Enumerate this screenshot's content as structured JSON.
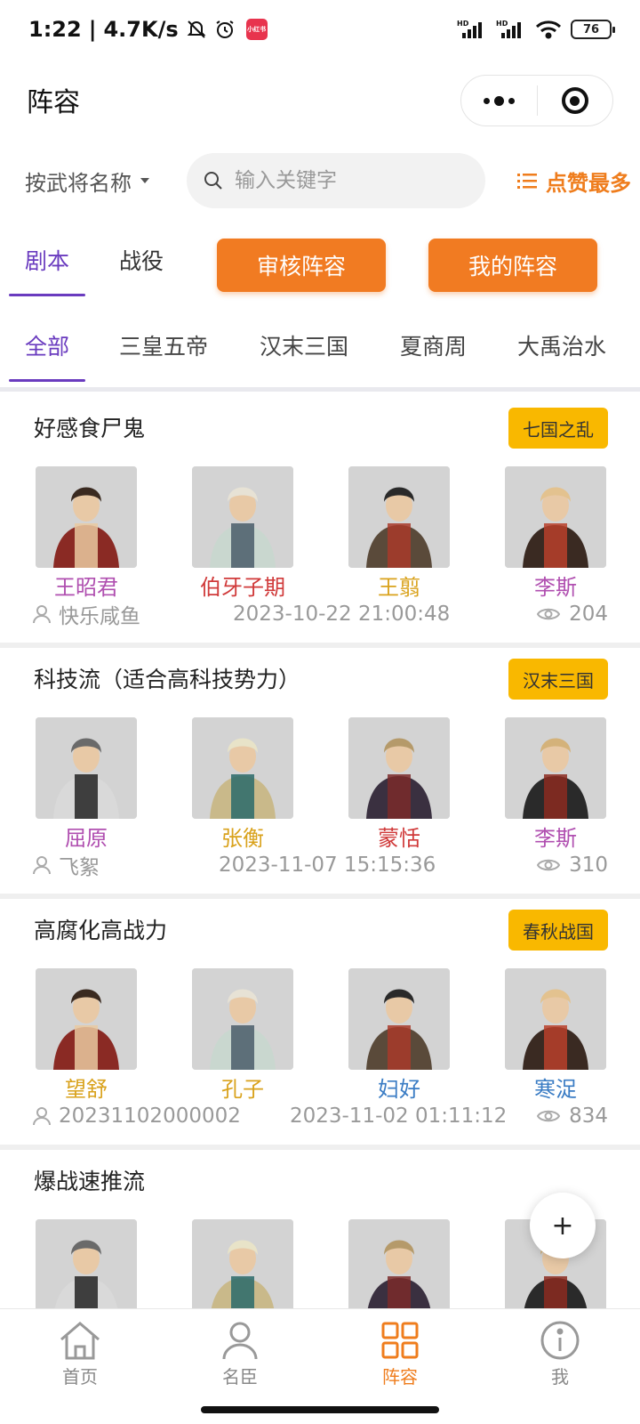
{
  "status_bar": {
    "time": "1:22",
    "net_speed": "4.7K/s",
    "mini_app": "小红书",
    "signal_1": "HD",
    "signal_2": "HD",
    "battery": "76"
  },
  "header": {
    "title": "阵容"
  },
  "search": {
    "filter_label": "按武将名称",
    "placeholder": "输入关键字",
    "sort_label": "点赞最多"
  },
  "tabs": {
    "items": [
      "剧本",
      "战役"
    ],
    "review_button": "审核阵容",
    "my_button": "我的阵容"
  },
  "categories": [
    "全部",
    "三皇五帝",
    "汉末三国",
    "夏商周",
    "大禹治水"
  ],
  "cards": [
    {
      "title": "好感食尸鬼",
      "tag": "七国之乱",
      "heroes": [
        {
          "name": "王昭君",
          "color": "#b04fb0"
        },
        {
          "name": "伯牙子期",
          "color": "#d03a3a"
        },
        {
          "name": "王翦",
          "color": "#d9a21c"
        },
        {
          "name": "李斯",
          "color": "#b04fb0"
        }
      ],
      "user": "快乐咸鱼",
      "date": "2023-10-22 21:00:48",
      "views": "204"
    },
    {
      "title": "科技流（适合高科技势力）",
      "tag": "汉末三国",
      "heroes": [
        {
          "name": "屈原",
          "color": "#b04fb0"
        },
        {
          "name": "张衡",
          "color": "#d9a21c"
        },
        {
          "name": "蒙恬",
          "color": "#d03a3a"
        },
        {
          "name": "李斯",
          "color": "#b04fb0"
        }
      ],
      "user": "飞絮",
      "date": "2023-11-07 15:15:36",
      "views": "310"
    },
    {
      "title": "高腐化高战力",
      "tag": "春秋战国",
      "heroes": [
        {
          "name": "望舒",
          "color": "#d9a21c"
        },
        {
          "name": "孔子",
          "color": "#d9a21c"
        },
        {
          "name": "妇好",
          "color": "#3a7cc4"
        },
        {
          "name": "寒浞",
          "color": "#3a7cc4"
        }
      ],
      "user": "20231102000002",
      "date": "2023-11-02 01:11:12",
      "views": "834"
    },
    {
      "title": "爆战速推流",
      "tag": "",
      "heroes": [
        {
          "name": "",
          "color": "#333"
        },
        {
          "name": "",
          "color": "#333"
        },
        {
          "name": "",
          "color": "#333"
        },
        {
          "name": "",
          "color": "#333"
        }
      ],
      "user": "",
      "date": "",
      "views": ""
    }
  ],
  "fab": {
    "label": "+"
  },
  "bottom_nav": [
    "首页",
    "名臣",
    "阵容",
    "我"
  ],
  "colors": {
    "accent": "#ef7d1d",
    "purple": "#6a3bbf",
    "tag": "#f9b800"
  }
}
